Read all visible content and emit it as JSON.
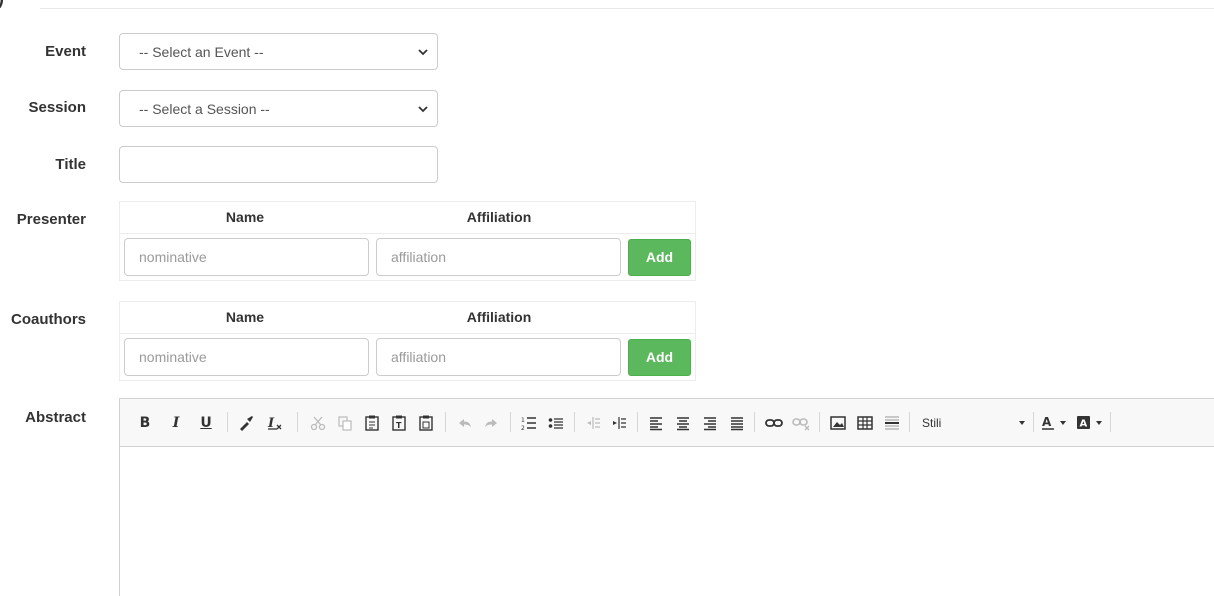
{
  "form": {
    "event": {
      "label": "Event",
      "value": "-- Select an Event --"
    },
    "session": {
      "label": "Session",
      "value": "-- Select a Session --"
    },
    "title": {
      "label": "Title",
      "value": ""
    },
    "presenter": {
      "label": "Presenter",
      "col_name": "Name",
      "col_affiliation": "Affiliation",
      "name_placeholder": "nominative",
      "affiliation_placeholder": "affiliation",
      "add_label": "Add"
    },
    "coauthors": {
      "label": "Coauthors",
      "col_name": "Name",
      "col_affiliation": "Affiliation",
      "name_placeholder": "nominative",
      "affiliation_placeholder": "affiliation",
      "add_label": "Add"
    },
    "abstract": {
      "label": "Abstract",
      "toolbar": {
        "bold": "B",
        "italic": "I",
        "underline": "U",
        "styles_label": "Stili"
      }
    }
  },
  "colors": {
    "add_button": "#5cb85c",
    "toolbar_bg": "#f8f8f8"
  }
}
